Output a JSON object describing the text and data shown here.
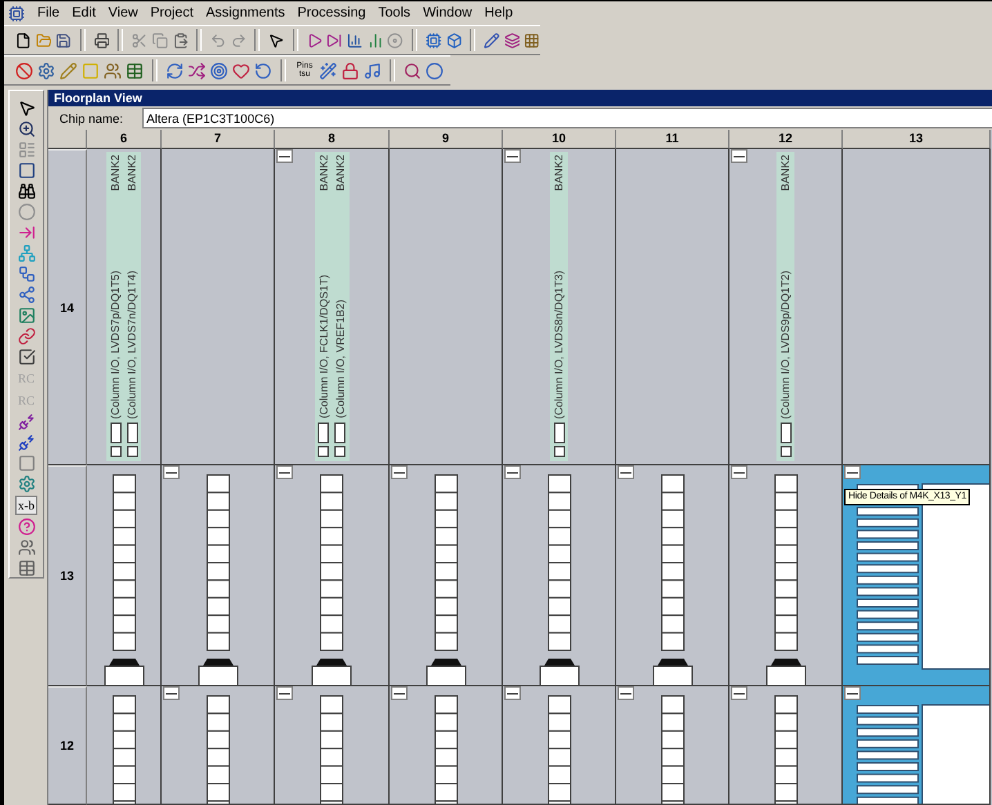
{
  "menu": [
    "File",
    "Edit",
    "View",
    "Project",
    "Assignments",
    "Processing",
    "Tools",
    "Window",
    "Help"
  ],
  "pins_button": {
    "line1": "Pins",
    "line2": "tsu"
  },
  "left_toolbar": [
    {
      "kind": "icon"
    },
    {
      "kind": "icon"
    },
    {
      "kind": "icon"
    },
    {
      "kind": "icon"
    },
    {
      "kind": "icon"
    },
    {
      "kind": "icon"
    },
    {
      "kind": "icon"
    },
    {
      "kind": "icon"
    },
    {
      "kind": "icon"
    },
    {
      "kind": "icon"
    },
    {
      "kind": "icon"
    },
    {
      "kind": "icon"
    },
    {
      "kind": "icon"
    },
    {
      "kind": "text",
      "label": "RC",
      "disabled": true
    },
    {
      "kind": "text",
      "label": "RC",
      "disabled": true
    },
    {
      "kind": "icon"
    },
    {
      "kind": "icon"
    },
    {
      "kind": "icon"
    },
    {
      "kind": "icon"
    },
    {
      "kind": "text",
      "label": "x-b",
      "disabled": false
    },
    {
      "kind": "icon"
    },
    {
      "kind": "icon"
    },
    {
      "kind": "icon"
    }
  ],
  "panel": {
    "title": "Floorplan View",
    "chip_label": "Chip name:",
    "chip_value": "Altera (EP1C3T100C6)"
  },
  "columns": [
    "6",
    "7",
    "8",
    "9",
    "10",
    "11",
    "12",
    "13"
  ],
  "rows": [
    {
      "label": "14",
      "cells": [
        {
          "kind": "io",
          "collapse": false,
          "pins": [
            {
              "bank": "BANK2",
              "label": "(Column I/O, LVDS7p/DQ1T5)"
            },
            {
              "bank": "BANK2",
              "label": "(Column I/O, LVDS7n/DQ1T4)"
            }
          ]
        },
        {
          "kind": "empty",
          "collapse": false
        },
        {
          "kind": "io",
          "collapse": true,
          "pins": [
            {
              "bank": "BANK2",
              "label": "(Column I/O, FCLK1/DQS1T)"
            },
            {
              "bank": "BANK2",
              "label": "(Column I/O, VREF1B2)"
            }
          ]
        },
        {
          "kind": "empty",
          "collapse": false
        },
        {
          "kind": "io",
          "collapse": true,
          "pins": [
            {
              "bank": "BANK2",
              "label": "(Column I/O, LVDS8n/DQ1T3)"
            }
          ]
        },
        {
          "kind": "empty",
          "collapse": false
        },
        {
          "kind": "io",
          "collapse": true,
          "pins": [
            {
              "bank": "BANK2",
              "label": "(Column I/O, LVDS9p/DQ1T2)"
            }
          ]
        },
        {
          "kind": "empty",
          "collapse": false
        }
      ]
    },
    {
      "label": "13",
      "cells": [
        {
          "kind": "lab",
          "collapse": false
        },
        {
          "kind": "lab",
          "collapse": true
        },
        {
          "kind": "lab",
          "collapse": true
        },
        {
          "kind": "lab",
          "collapse": true
        },
        {
          "kind": "lab",
          "collapse": true
        },
        {
          "kind": "lab",
          "collapse": true
        },
        {
          "kind": "lab",
          "collapse": true
        },
        {
          "kind": "m4k",
          "collapse": true,
          "tooltip": "Hide Details of M4K_X13_Y1"
        }
      ]
    },
    {
      "label": "12",
      "cells": [
        {
          "kind": "lab",
          "collapse": false
        },
        {
          "kind": "lab",
          "collapse": true
        },
        {
          "kind": "lab",
          "collapse": true
        },
        {
          "kind": "lab",
          "collapse": true
        },
        {
          "kind": "lab",
          "collapse": true
        },
        {
          "kind": "lab",
          "collapse": true
        },
        {
          "kind": "lab",
          "collapse": true
        },
        {
          "kind": "m4k",
          "collapse": true
        }
      ]
    }
  ]
}
